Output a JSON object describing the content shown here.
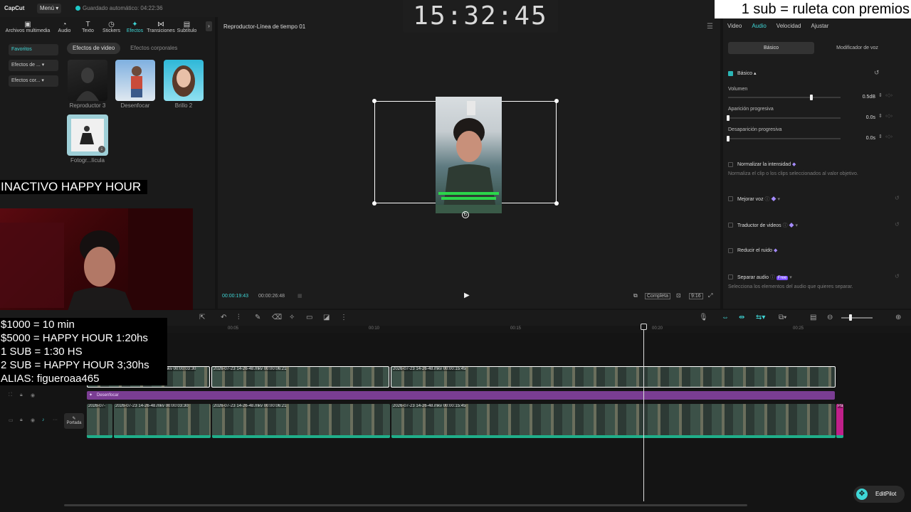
{
  "app": {
    "logo": "CapCut",
    "menu_label": "Menú ▾",
    "autosave": "Guardado automático: 04:22:36"
  },
  "stream_overlay": {
    "clock": "15:32:45",
    "top_right": "1 sub = ruleta con premios",
    "status": "INACTIVO HAPPY HOUR",
    "donations": [
      "$1000 = 10 min",
      "$5000 = HAPPY HOUR 1:20hs",
      "1 SUB = 1:30 HS",
      "2 SUB = HAPPY HOUR 3;30hs",
      "ALIAS: figueroaa465"
    ]
  },
  "left_panel": {
    "tabs": [
      {
        "label": "Archivos multimedia",
        "icon": "▣"
      },
      {
        "label": "Audio",
        "icon": "◔"
      },
      {
        "label": "Texto",
        "icon": "T"
      },
      {
        "label": "Stickers",
        "icon": "◷"
      },
      {
        "label": "Efectos",
        "icon": "✦"
      },
      {
        "label": "Transiciones",
        "icon": "⋈"
      },
      {
        "label": "Subtítulo",
        "icon": "▤"
      }
    ],
    "active_tab": "Efectos",
    "side_items": [
      "Favoritos",
      "Efectos de ... ▾",
      "Efectos cor... ▾"
    ],
    "filters": [
      "Efectos de video",
      "Efectos corporales"
    ],
    "effects": [
      "Reproductor 3",
      "Desenfocar",
      "Brillo 2",
      "Fotogr...lícula"
    ]
  },
  "player": {
    "title": "Reproductor-Línea de tiempo 01",
    "current_time": "00:00:19:43",
    "total_time": "00:00:26:48",
    "completa": "Completa",
    "ratio": "9:16"
  },
  "right_panel": {
    "tabs": [
      "Video",
      "Audio",
      "Velocidad",
      "Ajustar"
    ],
    "active_tab": "Audio",
    "subtabs": [
      "Básico",
      "Modificador de voz"
    ],
    "basic_title": "Básico ▴",
    "volume": {
      "label": "Volumen",
      "value": "0.5dB",
      "level": 0.74
    },
    "fade_in": {
      "label": "Aparición progresiva",
      "value": "0.0s",
      "level": 0
    },
    "fade_out": {
      "label": "Desaparición progresiva",
      "value": "0.0s",
      "level": 0
    },
    "normalize": {
      "title": "Normalizar la intensidad",
      "desc": "Normaliza el clip o los clips seleccionados al valor objetivo."
    },
    "enhance": "Mejorar voz",
    "translate": "Traductor de videos",
    "noise": "Reducir el ruido",
    "separate": {
      "title": "Separar audio",
      "badge": "Free",
      "desc": "Selecciona los elementos del audio que quieres separar."
    }
  },
  "timeline": {
    "ruler": [
      "00:05",
      "00:10",
      "00:15",
      "00:20",
      "00:25"
    ],
    "effect_label": "Desenfocar",
    "portada": "Portada",
    "top_clips": [
      "mkv  00:00:03:30",
      "2026-07-23 14-26-48.mkv  00:00:06:21",
      "2026-07-23 14-26-48.mkv  00:00:15:45"
    ],
    "main_clips": [
      "2026-07-",
      "2026-07-23 14-26-48.mkv  00:00:03:30",
      "2026-07-23 14-26-48.mkv  00:00:06:21",
      "2026-07-23 14-26-48.mkv  00:00:15:45",
      "Pa"
    ]
  },
  "assistant": {
    "label": "EditPilot"
  }
}
